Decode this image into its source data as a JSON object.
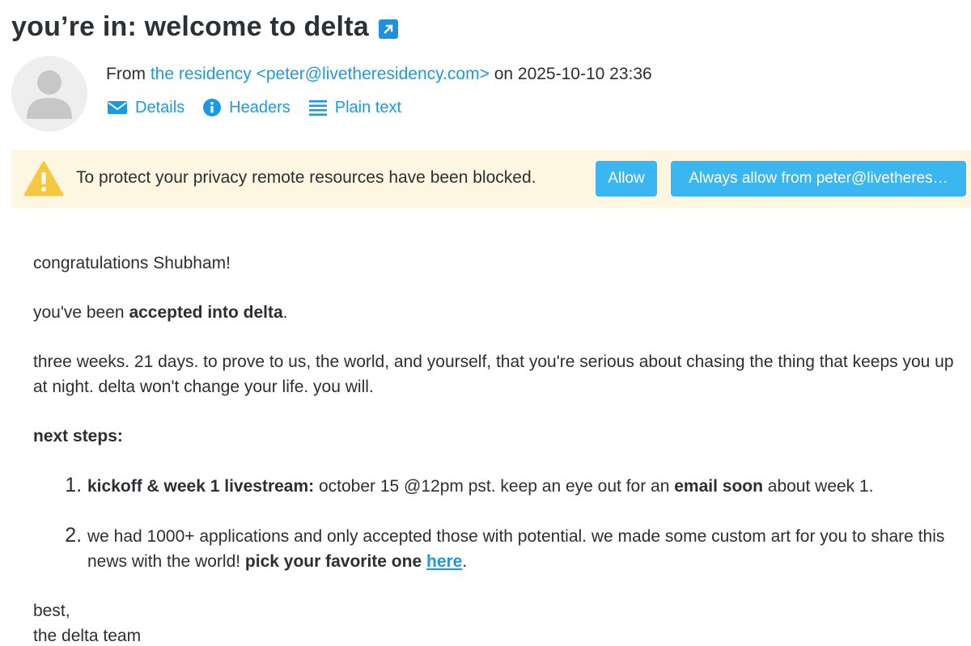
{
  "subject": {
    "title": "you’re in: welcome to delta",
    "open_icon": "external-link-icon"
  },
  "header": {
    "from_prefix": "From",
    "sender_name": "the residency",
    "sender_email": "<peter@livetheresidency.com>",
    "on_word": "on",
    "date": "2025-10-10 23:36",
    "actions": {
      "details": "Details",
      "headers": "Headers",
      "plain_text": "Plain text"
    }
  },
  "banner": {
    "message": "To protect your privacy remote resources have been blocked.",
    "allow": "Allow",
    "always_allow": "Always allow from peter@livetheres…"
  },
  "message": {
    "greeting": "congratulations Shubham!",
    "accepted_prefix": "you've been ",
    "accepted_bold": "accepted into delta",
    "accepted_suffix": ".",
    "paragraph": "three weeks. 21 days. to prove to us, the world, and yourself, that you're serious about chasing the thing that keeps you up at night. delta won't change your life. you will.",
    "next_steps": "next steps:",
    "steps": [
      {
        "bold": "kickoff & week 1 livestream:",
        "text": " october 15 @12pm pst. keep an eye out for an ",
        "bold2": "email soon",
        "text2": " about week 1."
      },
      {
        "text": "we had 1000+ applications and only accepted those with potential. we made some custom art for you to share this news with the world! ",
        "bold": "pick your favorite one",
        "space": " ",
        "link": "here",
        "end": "."
      }
    ],
    "signoff_1": "best,",
    "signoff_2": "the delta team"
  },
  "colors": {
    "link": "#1a9ae6",
    "button": "#3ab7f0",
    "banner_bg": "#fdf6e0",
    "warning": "#f5c842"
  }
}
